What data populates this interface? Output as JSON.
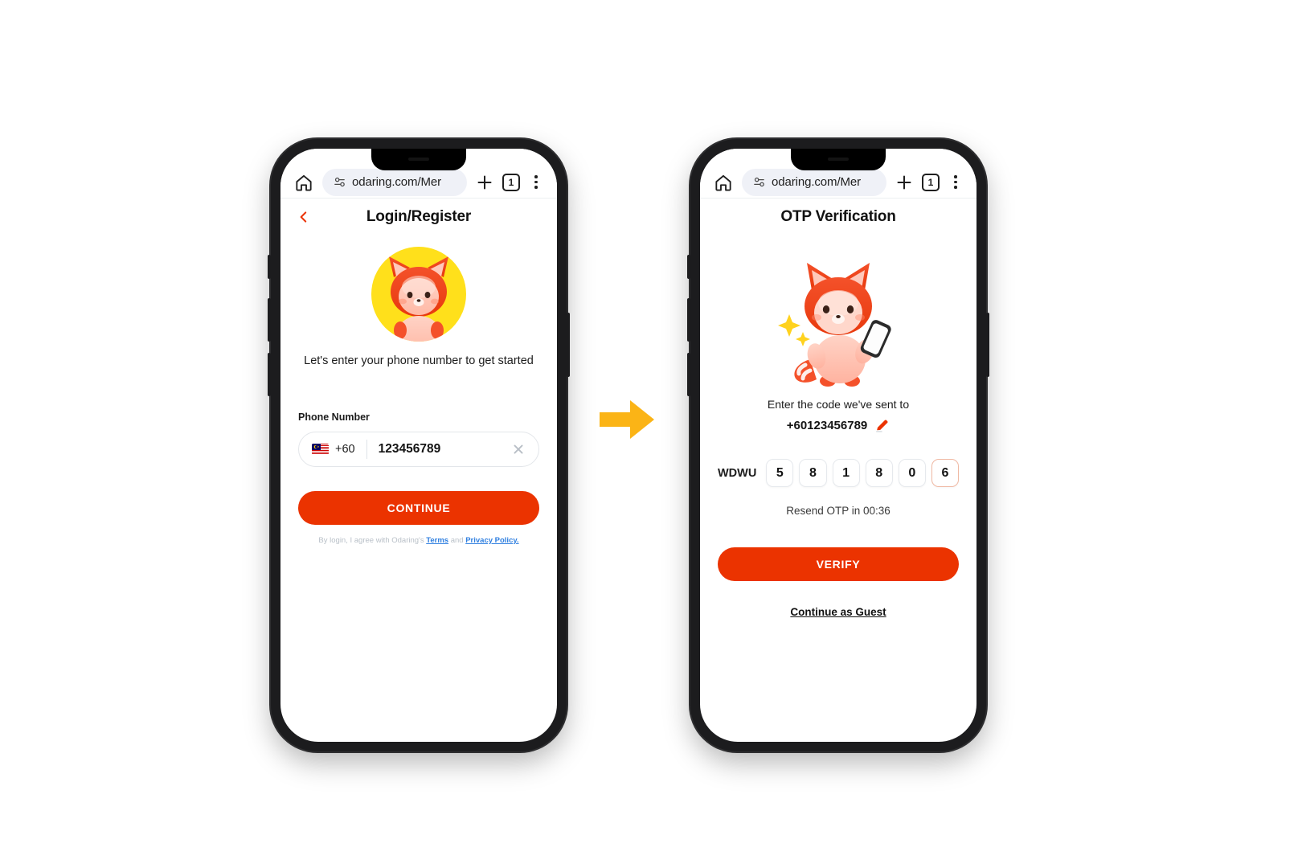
{
  "browser": {
    "url": "odaring.com/Mer",
    "tab_count": "1",
    "home_icon": "home-icon",
    "site_info_icon": "tune-icon",
    "new_tab_icon": "plus-icon",
    "menu_icon": "kebab-menu-icon"
  },
  "colors": {
    "accent": "#eb3300",
    "hero_bg": "#ffe01b",
    "link": "#2f7fe0",
    "arrow": "#fbb416"
  },
  "login_screen": {
    "title": "Login/Register",
    "back_icon": "chevron-left-icon",
    "mascot_icon": "fox-mascot-icon",
    "tagline": "Let's enter your phone number to get started",
    "phone_label": "Phone Number",
    "flag_icon": "malaysia-flag-icon",
    "dial_code": "+60",
    "phone_value": "123456789",
    "phone_placeholder": "Phone Number",
    "clear_icon": "close-x-icon",
    "continue_label": "CONTINUE",
    "legal_prefix": "By login, I agree with Odaring's",
    "legal_terms": "Terms",
    "legal_and": "and",
    "legal_privacy": "Privacy Policy."
  },
  "otp_screen": {
    "title": "OTP Verification",
    "mascot_icon": "fox-mascot-with-phone-icon",
    "sent_text": "Enter the code we've sent to",
    "phone_number": "+60123456789",
    "edit_icon": "pencil-edit-icon",
    "otp_prefix": "WDWU",
    "otp_digits": [
      "5",
      "8",
      "1",
      "8",
      "0",
      "6"
    ],
    "resend_text": "Resend OTP in 00:36",
    "verify_label": "VERIFY",
    "guest_label": "Continue as Guest"
  },
  "flow": {
    "arrow_icon": "arrow-right-icon"
  }
}
